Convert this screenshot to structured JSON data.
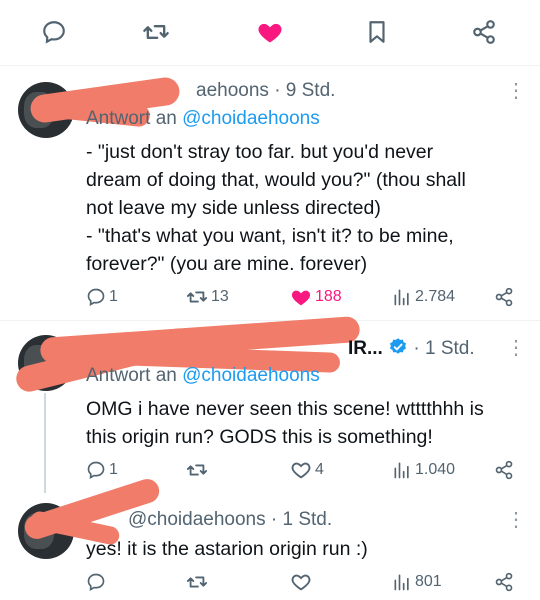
{
  "top_actions": {
    "reply_icon": "reply-icon",
    "retweet_icon": "retweet-icon",
    "like_icon": "heart-filled-icon",
    "bookmark_icon": "bookmark-icon",
    "share_icon": "share-icon",
    "like_color": "#f91880"
  },
  "tweets": [
    {
      "handle_fragment": "aehoons",
      "time": "· 9 Std.",
      "reply_prefix": "Antwort an",
      "reply_mention": "@choidaehoons",
      "lines": [
        "- \"just don't stray too far. but you'd never",
        "dream of doing that, would you?\" (thou shall",
        "not leave my side unless directed)",
        "- \"that's what you want, isn't it? to be mine,",
        "forever?\" (you are mine. forever)"
      ],
      "replies": "1",
      "retweets": "13",
      "likes": "188",
      "views": "2.784",
      "liked": true
    },
    {
      "name_fragment": "IR...",
      "time": "· 1 Std.",
      "reply_prefix": "Antwort an",
      "reply_mention": "@choidaehoons",
      "lines": [
        "OMG i have never seen this scene! wtttthhh is",
        "this origin run?  GODS this is something!"
      ],
      "replies": "1",
      "retweets": "",
      "likes": "4",
      "views": "1.040",
      "liked": false
    },
    {
      "handle": "@choidaehoons",
      "time": "· 1 Std.",
      "lines": [
        "yes! it is the astarion origin run :)"
      ],
      "replies": "",
      "retweets": "",
      "likes": "",
      "views": "801",
      "liked": false
    }
  ],
  "more_label": "⋮"
}
